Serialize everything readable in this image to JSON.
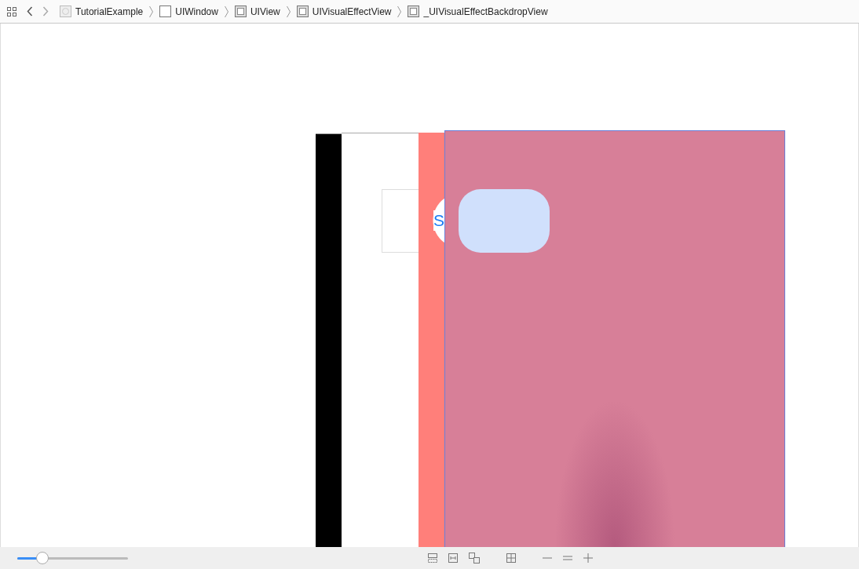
{
  "breadcrumb": [
    {
      "kind": "app",
      "label": "TutorialExample"
    },
    {
      "kind": "window",
      "label": "UIWindow"
    },
    {
      "kind": "view",
      "label": "UIView"
    },
    {
      "kind": "view",
      "label": "UIVisualEffectView"
    },
    {
      "kind": "view",
      "label": "_UIVisualEffectBackdropView"
    }
  ],
  "canvas": {
    "button_text": "S"
  },
  "bottom_bar": {
    "spacing_slider": {
      "level": 0.23
    }
  }
}
